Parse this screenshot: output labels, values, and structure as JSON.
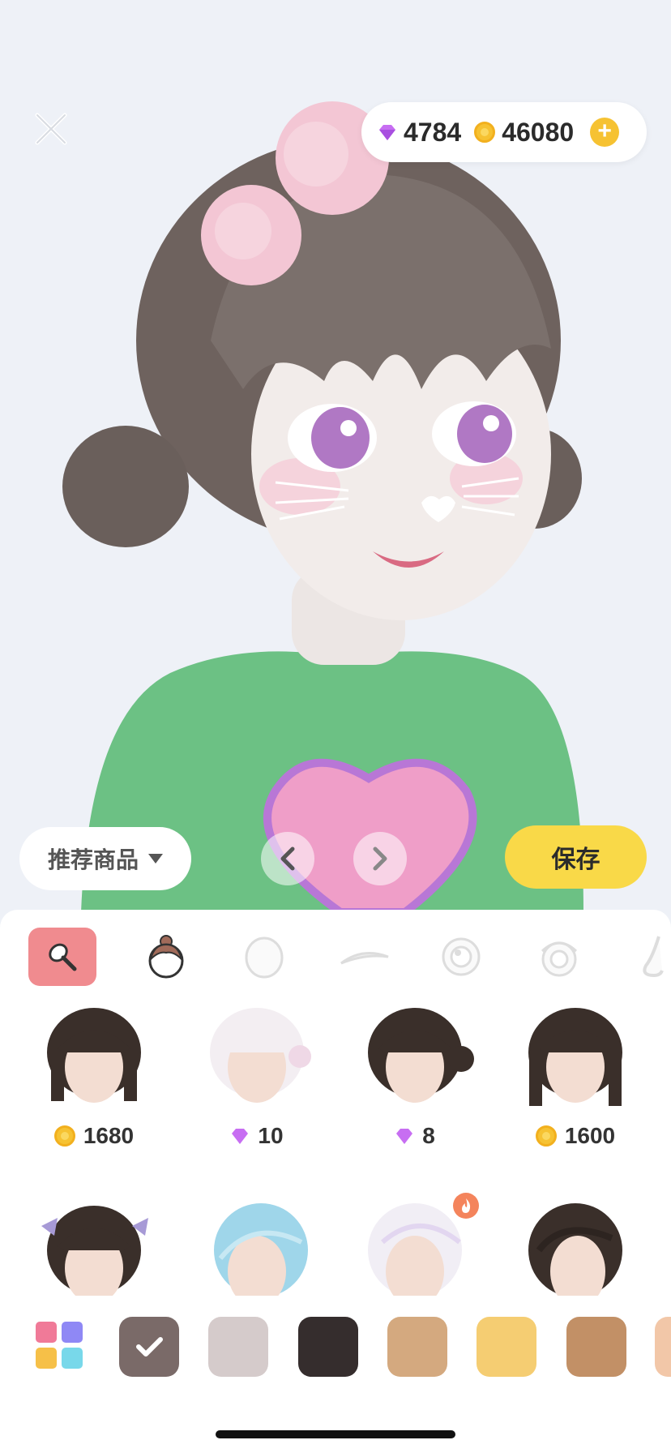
{
  "currency": {
    "gems": "4784",
    "coins": "46080"
  },
  "buttons": {
    "recommended": "推荐商品",
    "save": "保存"
  },
  "categories": [
    {
      "name": "makeup",
      "active": true
    },
    {
      "name": "hair",
      "active": false
    },
    {
      "name": "face",
      "active": false
    },
    {
      "name": "eyebrow",
      "active": false
    },
    {
      "name": "eye",
      "active": false
    },
    {
      "name": "eye-detail",
      "active": false
    },
    {
      "name": "nose",
      "active": false
    }
  ],
  "items": [
    {
      "price": "1680",
      "currency": "coin",
      "hair_color": "#3a2f2a"
    },
    {
      "price": "10",
      "currency": "gem",
      "hair_color": "#f3eef2"
    },
    {
      "price": "8",
      "currency": "gem",
      "hair_color": "#3a2f2a"
    },
    {
      "price": "1600",
      "currency": "coin",
      "hair_color": "#3a2f2a"
    },
    {
      "price": "",
      "currency": "",
      "hair_color": "#3a2f2a"
    },
    {
      "price": "",
      "currency": "",
      "hair_color": "#9fd6ea"
    },
    {
      "price": "",
      "currency": "",
      "hair_color": "#f1eef5",
      "hot": true
    },
    {
      "price": "",
      "currency": "",
      "hair_color": "#3a2f2a"
    }
  ],
  "swatches": [
    "#7a6a68",
    "#d5cbcb",
    "#352d2d",
    "#d4a97f",
    "#f5cd72",
    "#c29066",
    "#f2c7a8"
  ],
  "colors": {
    "accent_yellow": "#f9d948",
    "active_tab": "#f08b8f"
  }
}
